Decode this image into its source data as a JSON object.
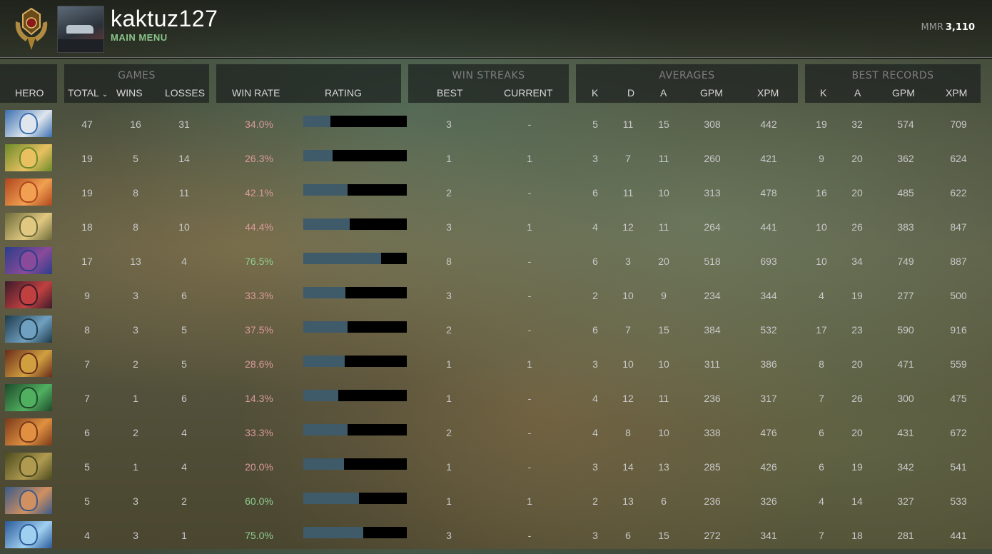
{
  "header": {
    "username": "kaktuz127",
    "breadcrumb": "MAIN MENU",
    "mmr_label": "MMR",
    "mmr_value": "3,110"
  },
  "columns": {
    "hero": "HERO",
    "games_group": "GAMES",
    "total": "TOTAL",
    "wins": "WINS",
    "losses": "LOSSES",
    "win_rate": "WIN RATE",
    "rating": "RATING",
    "streaks_group": "WIN STREAKS",
    "best": "BEST",
    "current": "CURRENT",
    "averages_group": "AVERAGES",
    "k": "K",
    "d": "D",
    "a": "A",
    "gpm": "GPM",
    "xpm": "XPM",
    "records_group": "BEST RECORDS",
    "rec_k": "K",
    "rec_a": "A",
    "rec_gpm": "GPM",
    "rec_xpm": "XPM"
  },
  "rows": [
    {
      "hero_icon": "zeus-portrait-icon",
      "colors": [
        "#3a6fb0",
        "#dfe6ee"
      ],
      "total": "47",
      "wins": "16",
      "losses": "31",
      "win_rate": "34.0%",
      "rating": 0.26,
      "best": "3",
      "current": "-",
      "k": "5",
      "d": "11",
      "a": "15",
      "gpm": "308",
      "xpm": "442",
      "rk": "19",
      "ra": "32",
      "rgpm": "574",
      "rxpm": "709"
    },
    {
      "hero_icon": "windranger-portrait-icon",
      "colors": [
        "#6b8a2a",
        "#e8c060"
      ],
      "total": "19",
      "wins": "5",
      "losses": "14",
      "win_rate": "26.3%",
      "rating": 0.28,
      "best": "1",
      "current": "1",
      "k": "3",
      "d": "7",
      "a": "11",
      "gpm": "260",
      "xpm": "421",
      "rk": "9",
      "ra": "20",
      "rgpm": "362",
      "rxpm": "624"
    },
    {
      "hero_icon": "lina-portrait-icon",
      "colors": [
        "#b0461e",
        "#f0a050"
      ],
      "total": "19",
      "wins": "8",
      "losses": "11",
      "win_rate": "42.1%",
      "rating": 0.43,
      "best": "2",
      "current": "-",
      "k": "6",
      "d": "11",
      "a": "10",
      "gpm": "313",
      "xpm": "478",
      "rk": "16",
      "ra": "20",
      "rgpm": "485",
      "rxpm": "622"
    },
    {
      "hero_icon": "omniknight-portrait-icon",
      "colors": [
        "#6b6a3a",
        "#e0c880"
      ],
      "total": "18",
      "wins": "8",
      "losses": "10",
      "win_rate": "44.4%",
      "rating": 0.45,
      "best": "3",
      "current": "1",
      "k": "4",
      "d": "12",
      "a": "11",
      "gpm": "264",
      "xpm": "441",
      "rk": "10",
      "ra": "26",
      "rgpm": "383",
      "rxpm": "847"
    },
    {
      "hero_icon": "ogre-magi-portrait-icon",
      "colors": [
        "#2a3e8a",
        "#8a4a9a"
      ],
      "total": "17",
      "wins": "13",
      "losses": "4",
      "win_rate": "76.5%",
      "rating": 0.75,
      "best": "8",
      "current": "-",
      "k": "6",
      "d": "3",
      "a": "20",
      "gpm": "518",
      "xpm": "693",
      "rk": "10",
      "ra": "34",
      "rgpm": "749",
      "rxpm": "887"
    },
    {
      "hero_icon": "shadow-demon-portrait-icon",
      "colors": [
        "#3a1a2a",
        "#c04040"
      ],
      "total": "9",
      "wins": "3",
      "losses": "6",
      "win_rate": "33.3%",
      "rating": 0.41,
      "best": "3",
      "current": "-",
      "k": "2",
      "d": "10",
      "a": "9",
      "gpm": "234",
      "xpm": "344",
      "rk": "4",
      "ra": "19",
      "rgpm": "277",
      "rxpm": "500"
    },
    {
      "hero_icon": "ancient-apparition-portrait-icon",
      "colors": [
        "#1e3a4a",
        "#70a0c0"
      ],
      "total": "8",
      "wins": "3",
      "losses": "5",
      "win_rate": "37.5%",
      "rating": 0.43,
      "best": "2",
      "current": "-",
      "k": "6",
      "d": "7",
      "a": "15",
      "gpm": "384",
      "xpm": "532",
      "rk": "17",
      "ra": "23",
      "rgpm": "590",
      "rxpm": "916"
    },
    {
      "hero_icon": "huskar-portrait-icon",
      "colors": [
        "#6a2a1a",
        "#d0a040"
      ],
      "total": "7",
      "wins": "2",
      "losses": "5",
      "win_rate": "28.6%",
      "rating": 0.4,
      "best": "1",
      "current": "1",
      "k": "3",
      "d": "10",
      "a": "10",
      "gpm": "311",
      "xpm": "386",
      "rk": "8",
      "ra": "20",
      "rgpm": "471",
      "rxpm": "559"
    },
    {
      "hero_icon": "venomancer-portrait-icon",
      "colors": [
        "#1e4a2a",
        "#50b060"
      ],
      "total": "7",
      "wins": "1",
      "losses": "6",
      "win_rate": "14.3%",
      "rating": 0.34,
      "best": "1",
      "current": "-",
      "k": "4",
      "d": "12",
      "a": "11",
      "gpm": "236",
      "xpm": "317",
      "rk": "7",
      "ra": "26",
      "rgpm": "300",
      "rxpm": "475"
    },
    {
      "hero_icon": "batrider-portrait-icon",
      "colors": [
        "#7a3a1a",
        "#e09040"
      ],
      "total": "6",
      "wins": "2",
      "losses": "4",
      "win_rate": "33.3%",
      "rating": 0.43,
      "best": "2",
      "current": "-",
      "k": "4",
      "d": "8",
      "a": "10",
      "gpm": "338",
      "xpm": "476",
      "rk": "6",
      "ra": "20",
      "rgpm": "431",
      "rxpm": "672"
    },
    {
      "hero_icon": "pudge-portrait-icon",
      "colors": [
        "#4a4a1e",
        "#b09a50"
      ],
      "total": "5",
      "wins": "1",
      "losses": "4",
      "win_rate": "20.0%",
      "rating": 0.39,
      "best": "1",
      "current": "-",
      "k": "3",
      "d": "14",
      "a": "13",
      "gpm": "285",
      "xpm": "426",
      "rk": "6",
      "ra": "19",
      "rgpm": "342",
      "rxpm": "541"
    },
    {
      "hero_icon": "sniper-portrait-icon",
      "colors": [
        "#3a5a8a",
        "#d09060"
      ],
      "total": "5",
      "wins": "3",
      "losses": "2",
      "win_rate": "60.0%",
      "rating": 0.54,
      "best": "1",
      "current": "1",
      "k": "2",
      "d": "13",
      "a": "6",
      "gpm": "236",
      "xpm": "326",
      "rk": "4",
      "ra": "14",
      "rgpm": "327",
      "rxpm": "533"
    },
    {
      "hero_icon": "crystal-maiden-portrait-icon",
      "colors": [
        "#2a5a9a",
        "#a0d0f0"
      ],
      "total": "4",
      "wins": "3",
      "losses": "1",
      "win_rate": "75.0%",
      "rating": 0.58,
      "best": "3",
      "current": "-",
      "k": "3",
      "d": "6",
      "a": "15",
      "gpm": "272",
      "xpm": "341",
      "rk": "7",
      "ra": "18",
      "rgpm": "281",
      "rxpm": "441"
    }
  ]
}
